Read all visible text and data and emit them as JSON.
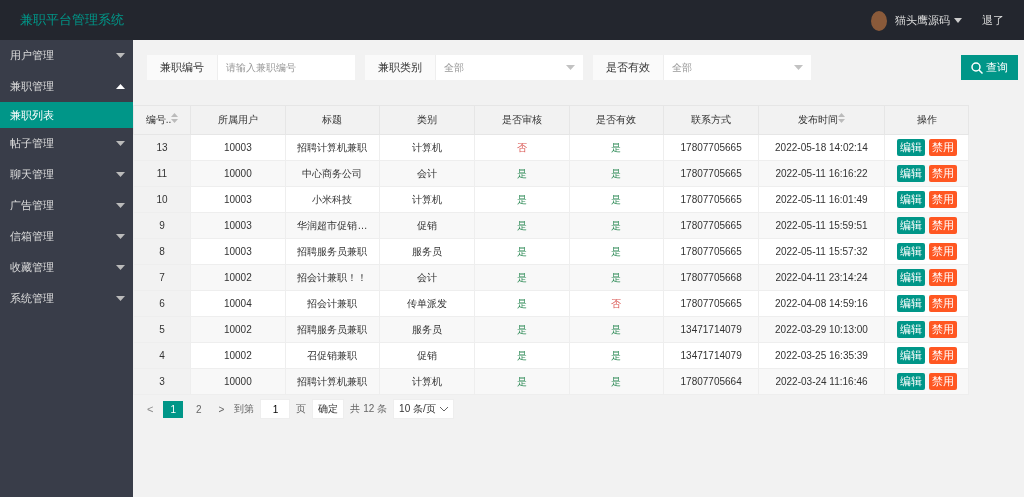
{
  "header": {
    "title": "兼职平台管理系统",
    "user": "猫头鹰源码",
    "logout": "退了"
  },
  "sidebar": {
    "items": [
      {
        "label": "用户管理",
        "expanded": false
      },
      {
        "label": "兼职管理",
        "expanded": true,
        "children": [
          {
            "label": "兼职列表",
            "selected": true
          }
        ]
      },
      {
        "label": "帖子管理",
        "expanded": false
      },
      {
        "label": "聊天管理",
        "expanded": false
      },
      {
        "label": "广告管理",
        "expanded": false
      },
      {
        "label": "信箱管理",
        "expanded": false
      },
      {
        "label": "收藏管理",
        "expanded": false
      },
      {
        "label": "系统管理",
        "expanded": false
      }
    ]
  },
  "filters": [
    {
      "label": "兼职编号",
      "kind": "input",
      "placeholder": "请输入兼职编号"
    },
    {
      "label": "兼职类别",
      "kind": "select",
      "value": "全部"
    },
    {
      "label": "是否有效",
      "kind": "select",
      "value": "全部"
    }
  ],
  "search_button": "查询",
  "table": {
    "columns": [
      {
        "label": "编号..",
        "sortable": true
      },
      {
        "label": "所属用户",
        "sortable": false
      },
      {
        "label": "标题",
        "sortable": false
      },
      {
        "label": "类别",
        "sortable": false
      },
      {
        "label": "是否审核",
        "sortable": false
      },
      {
        "label": "是否有效",
        "sortable": false
      },
      {
        "label": "联系方式",
        "sortable": false
      },
      {
        "label": "发布时间",
        "sortable": true
      },
      {
        "label": "操作",
        "sortable": false
      }
    ],
    "rows": [
      {
        "id": "13",
        "user": "10003",
        "title": "招聘计算机兼职",
        "category": "计算机",
        "reviewed": {
          "text": "否",
          "ok": false
        },
        "valid": {
          "text": "是",
          "ok": true
        },
        "contact": "17807705665",
        "time": "2022-05-18 14:02:14",
        "actions": [
          "编辑",
          "禁用"
        ]
      },
      {
        "id": "11",
        "user": "10000",
        "title": "中心商务公司",
        "category": "会计",
        "reviewed": {
          "text": "是",
          "ok": true
        },
        "valid": {
          "text": "是",
          "ok": true
        },
        "contact": "17807705665",
        "time": "2022-05-11 16:16:22",
        "actions": [
          "编辑",
          "禁用"
        ]
      },
      {
        "id": "10",
        "user": "10003",
        "title": "小米科技",
        "category": "计算机",
        "reviewed": {
          "text": "是",
          "ok": true
        },
        "valid": {
          "text": "是",
          "ok": true
        },
        "contact": "17807705665",
        "time": "2022-05-11 16:01:49",
        "actions": [
          "编辑",
          "禁用"
        ]
      },
      {
        "id": "9",
        "user": "10003",
        "title": "华润超市促销…",
        "category": "促销",
        "reviewed": {
          "text": "是",
          "ok": true
        },
        "valid": {
          "text": "是",
          "ok": true
        },
        "contact": "17807705665",
        "time": "2022-05-11 15:59:51",
        "actions": [
          "编辑",
          "禁用"
        ]
      },
      {
        "id": "8",
        "user": "10003",
        "title": "招聘服务员兼职",
        "category": "服务员",
        "reviewed": {
          "text": "是",
          "ok": true
        },
        "valid": {
          "text": "是",
          "ok": true
        },
        "contact": "17807705665",
        "time": "2022-05-11 15:57:32",
        "actions": [
          "编辑",
          "禁用"
        ]
      },
      {
        "id": "7",
        "user": "10002",
        "title": "招会计兼职！！",
        "category": "会计",
        "reviewed": {
          "text": "是",
          "ok": true
        },
        "valid": {
          "text": "是",
          "ok": true
        },
        "contact": "17807705668",
        "time": "2022-04-11 23:14:24",
        "actions": [
          "编辑",
          "禁用"
        ]
      },
      {
        "id": "6",
        "user": "10004",
        "title": "招会计兼职",
        "category": "传单派发",
        "reviewed": {
          "text": "是",
          "ok": true
        },
        "valid": {
          "text": "否",
          "ok": false
        },
        "contact": "17807705665",
        "time": "2022-04-08 14:59:16",
        "actions": [
          "编辑",
          "禁用"
        ]
      },
      {
        "id": "5",
        "user": "10002",
        "title": "招聘服务员兼职",
        "category": "服务员",
        "reviewed": {
          "text": "是",
          "ok": true
        },
        "valid": {
          "text": "是",
          "ok": true
        },
        "contact": "13471714079",
        "time": "2022-03-29 10:13:00",
        "actions": [
          "编辑",
          "禁用"
        ]
      },
      {
        "id": "4",
        "user": "10002",
        "title": "召促销兼职",
        "category": "促销",
        "reviewed": {
          "text": "是",
          "ok": true
        },
        "valid": {
          "text": "是",
          "ok": true
        },
        "contact": "13471714079",
        "time": "2022-03-25 16:35:39",
        "actions": [
          "编辑",
          "禁用"
        ]
      },
      {
        "id": "3",
        "user": "10000",
        "title": "招聘计算机兼职",
        "category": "计算机",
        "reviewed": {
          "text": "是",
          "ok": true
        },
        "valid": {
          "text": "是",
          "ok": true
        },
        "contact": "17807705664",
        "time": "2022-03-24 11:16:46",
        "actions": [
          "编辑",
          "禁用"
        ]
      }
    ]
  },
  "pagination": {
    "prev": "<",
    "pages": [
      {
        "label": "1",
        "selected": true
      },
      {
        "label": "2",
        "selected": false
      }
    ],
    "next": ">",
    "goto_label": "到第",
    "goto_value": "1",
    "page_unit": "页",
    "confirm": "确定",
    "total": "共 12 条",
    "page_size": "10 条/页"
  }
}
